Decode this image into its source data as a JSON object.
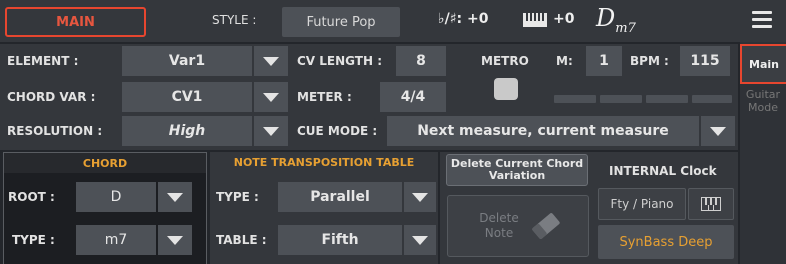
{
  "topbar": {
    "main_label": "MAIN",
    "style_label": "STYLE :",
    "style_value": "Future Pop",
    "key_signature": "♭/♯: +0",
    "keyboard_transpose": "+0",
    "chord_root": "D",
    "chord_ext": "m7"
  },
  "params": {
    "element_label": "ELEMENT :",
    "element_value": "Var1",
    "chord_var_label": "CHORD VAR :",
    "chord_var_value": "CV1",
    "resolution_label": "RESOLUTION :",
    "resolution_value": "High",
    "cv_length_label": "CV LENGTH :",
    "cv_length_value": "8",
    "meter_label": "METER :",
    "meter_value": "4/4",
    "cue_mode_label": "CUE MODE :",
    "cue_mode_value": "Next measure, current measure",
    "metro_label": "METRO",
    "m_label": "M:",
    "m_value": "1",
    "bpm_label": "BPM :",
    "bpm_value": "115"
  },
  "side_tabs": {
    "main": "Main",
    "guitar_mode": "Guitar Mode"
  },
  "chord_panel": {
    "title": "CHORD",
    "root_label": "ROOT :",
    "root_value": "D",
    "type_label": "TYPE :",
    "type_value": "m7"
  },
  "transpose_panel": {
    "title": "NOTE TRANSPOSITION TABLE",
    "type_label": "TYPE :",
    "type_value": "Parallel",
    "table_label": "TABLE :",
    "table_value": "Fifth"
  },
  "actions": {
    "delete_cv": "Delete Current Chord Variation",
    "delete_note": "Delete Note",
    "internal_clock": "INTERNAL Clock",
    "fty_piano": "Fty / Piano",
    "synbass": "SynBass Deep"
  }
}
